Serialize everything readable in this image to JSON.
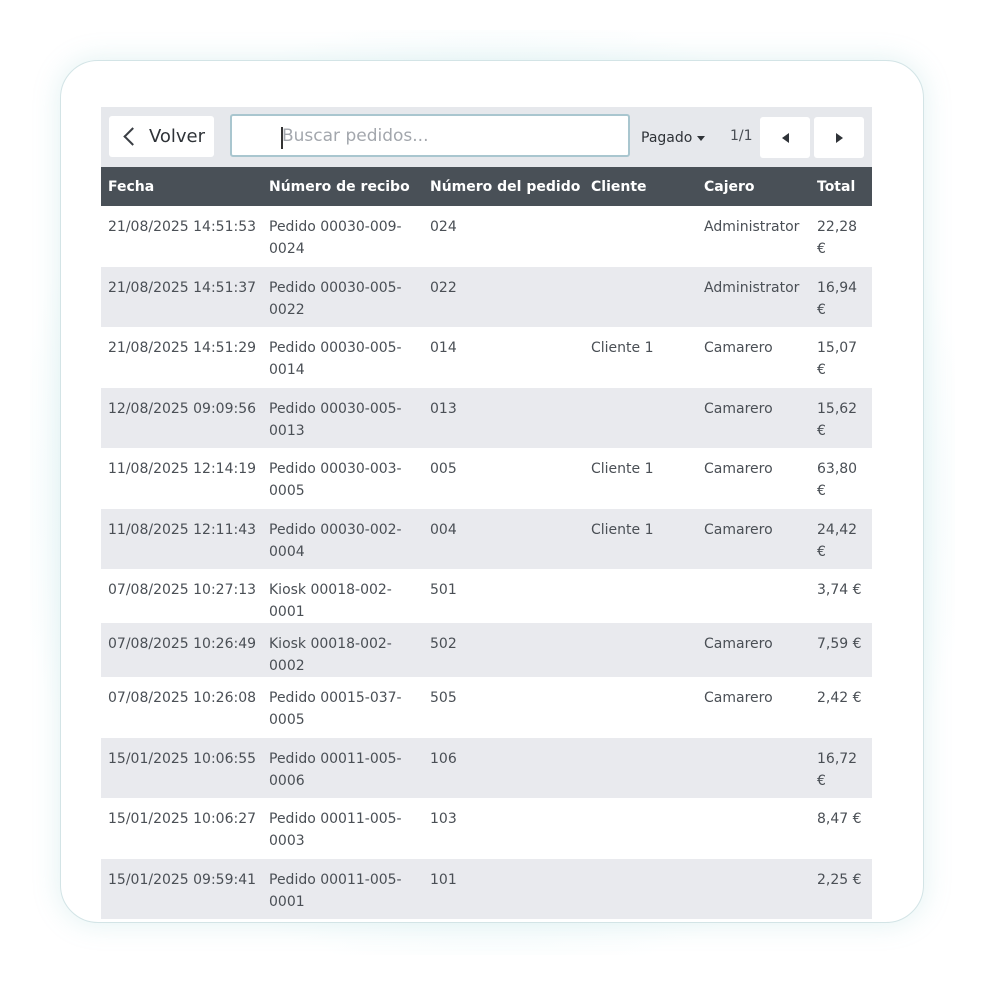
{
  "toolbar": {
    "back_label": "Volver",
    "search_placeholder": "Buscar pedidos...",
    "search_value": "",
    "status_filter": "Pagado",
    "page_info": "1/1"
  },
  "table": {
    "columns": [
      "Fecha",
      "Número de recibo",
      "Número del pedido",
      "Cliente",
      "Cajero",
      "Total"
    ],
    "rows": [
      {
        "fecha": "21/08/2025 14:51:53",
        "recibo": "Pedido 00030-009-0024",
        "pedido": "024",
        "cliente": "",
        "cajero": "Administrator",
        "total": "22,28 €"
      },
      {
        "fecha": "21/08/2025 14:51:37",
        "recibo": "Pedido 00030-005-0022",
        "pedido": "022",
        "cliente": "",
        "cajero": "Administrator",
        "total": "16,94 €"
      },
      {
        "fecha": "21/08/2025 14:51:29",
        "recibo": "Pedido 00030-005-0014",
        "pedido": "014",
        "cliente": "Cliente 1",
        "cajero": "Camarero",
        "total": "15,07 €"
      },
      {
        "fecha": "12/08/2025 09:09:56",
        "recibo": "Pedido 00030-005-0013",
        "pedido": "013",
        "cliente": "",
        "cajero": "Camarero",
        "total": "15,62 €"
      },
      {
        "fecha": "11/08/2025 12:14:19",
        "recibo": "Pedido 00030-003-0005",
        "pedido": "005",
        "cliente": "Cliente 1",
        "cajero": "Camarero",
        "total": "63,80 €"
      },
      {
        "fecha": "11/08/2025 12:11:43",
        "recibo": "Pedido 00030-002-0004",
        "pedido": "004",
        "cliente": "Cliente 1",
        "cajero": "Camarero",
        "total": "24,42 €"
      },
      {
        "fecha": "07/08/2025 10:27:13",
        "recibo": "Kiosk 00018-002-0001",
        "pedido": "501",
        "cliente": "",
        "cajero": "",
        "total": "3,74 €"
      },
      {
        "fecha": "07/08/2025 10:26:49",
        "recibo": "Kiosk 00018-002-0002",
        "pedido": "502",
        "cliente": "",
        "cajero": "Camarero",
        "total": "7,59 €"
      },
      {
        "fecha": "07/08/2025 10:26:08",
        "recibo": "Pedido 00015-037-0005",
        "pedido": "505",
        "cliente": "",
        "cajero": "Camarero",
        "total": "2,42 €"
      },
      {
        "fecha": "15/01/2025 10:06:55",
        "recibo": "Pedido 00011-005-0006",
        "pedido": "106",
        "cliente": "",
        "cajero": "",
        "total": "16,72 €"
      },
      {
        "fecha": "15/01/2025 10:06:27",
        "recibo": "Pedido 00011-005-0003",
        "pedido": "103",
        "cliente": "",
        "cajero": "",
        "total": "8,47 €"
      },
      {
        "fecha": "15/01/2025 09:59:41",
        "recibo": "Pedido 00011-005-0001",
        "pedido": "101",
        "cliente": "",
        "cajero": "",
        "total": "2,25 €"
      }
    ]
  }
}
